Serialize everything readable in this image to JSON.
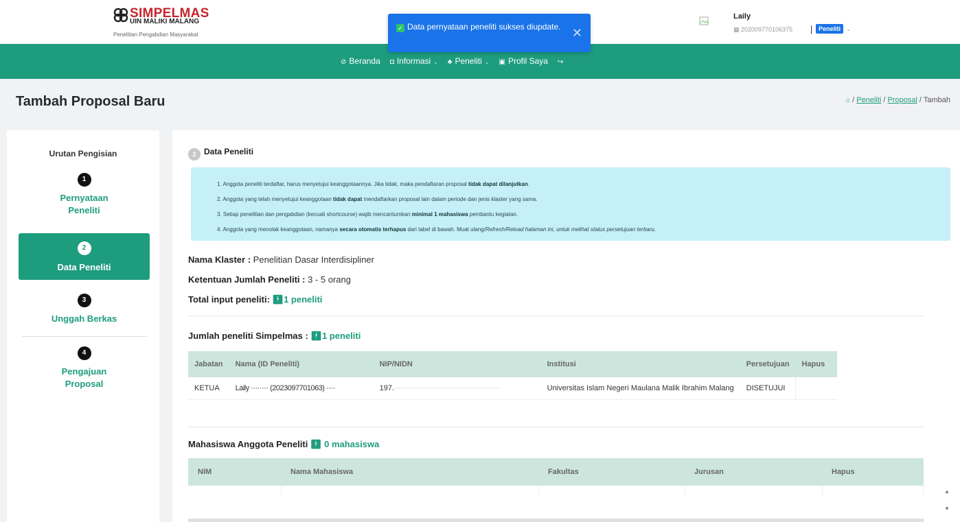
{
  "header": {
    "logo_title": "SIMPELMAS",
    "logo_sub": "UIN MALIKI MALANG",
    "logo_tagline": "Penelitian Pengabdian Masyarakat"
  },
  "toast": {
    "message": "Data pernyataan peneliti sukses diupdate.",
    "close": "✕"
  },
  "user": {
    "name": "Laily",
    "id": "202009770106375",
    "role": "Peneliti"
  },
  "nav": {
    "beranda": "Beranda",
    "informasi": "Informasi",
    "peneliti": "Peneliti",
    "profil": "Profil Saya"
  },
  "page": {
    "title": "Tambah Proposal Baru",
    "breadcrumb": [
      "Peneliti",
      "Proposal",
      "Tambah"
    ]
  },
  "sidebar": {
    "heading": "Urutan Pengisian",
    "steps": [
      {
        "num": "1",
        "label": "Pernyataan Peneliti"
      },
      {
        "num": "2",
        "label": "Data Peneliti"
      },
      {
        "num": "3",
        "label": "Unggah Berkas"
      },
      {
        "num": "4",
        "label": "Pengajuan Proposal"
      }
    ]
  },
  "main": {
    "section_num": "2",
    "section_title": "Data Peneliti",
    "alert": {
      "l1_a": "1. Anggota peneliti terdaftar, harus menyetujui keanggotaannya. Jika tidak, maka pendaftaran proposal ",
      "l1_b": "tidak dapat dilanjutkan",
      "l1_c": ".",
      "l2_a": "2. Anggota yang telah menyetujui keanggotaan ",
      "l2_b": "tidak dapat",
      "l2_c": " mendaftarkan proposal lain dalam periode dan jenis klaster yang sama.",
      "l3_a": "3. Setiap penelitian dan pengabdian (kecuali shortcourse) wajib mencantumkan ",
      "l3_b": "minimal 1 mahasiswa",
      "l3_c": " pembantu kegiatan.",
      "l4_a": "4. Anggota yang menolak keanggotaan, namanya ",
      "l4_b": "secara otomatis terhapus",
      "l4_c": " dari tabel di bawah. Muat ulang/",
      "l4_d": "Refresh/Reload halaman ini, untuk melihat status persetujuan terbaru."
    },
    "nama_klaster_label": "Nama Klaster :",
    "nama_klaster_value": "Penelitian Dasar Interdisipliner",
    "ketentuan_label": "Ketentuan Jumlah Peneliti :",
    "ketentuan_value": "3 - 5 orang",
    "total_label": "Total input peneliti:",
    "total_value": "1 peneliti",
    "simpelmas_label": "Jumlah peneliti Simpelmas :",
    "simpelmas_value": "1 peneliti",
    "peneliti_table": {
      "headers": [
        "Jabatan",
        "Nama (ID Peneliti)",
        "NIP/NIDN",
        "Institusi",
        "Persetujuan",
        "Hapus"
      ],
      "rows": [
        {
          "jabatan": "KETUA",
          "nama": "Laily ········ (2023097701063) ····",
          "nip": "197.",
          "nip_blur": "·················································",
          "institusi": "Universitas Islam Negeri Maulana Malik Ibrahim Malang",
          "persetujuan": "DISETUJUI",
          "hapus": ""
        }
      ]
    },
    "mahasiswa_label": "Mahasiswa Anggota Peneliti",
    "mahasiswa_value": "0 mahasiswa",
    "mahasiswa_table": {
      "headers": [
        "NIM",
        "Nama Mahasiswa",
        "Fakultas",
        "Jurusan",
        "Hapus"
      ]
    }
  }
}
